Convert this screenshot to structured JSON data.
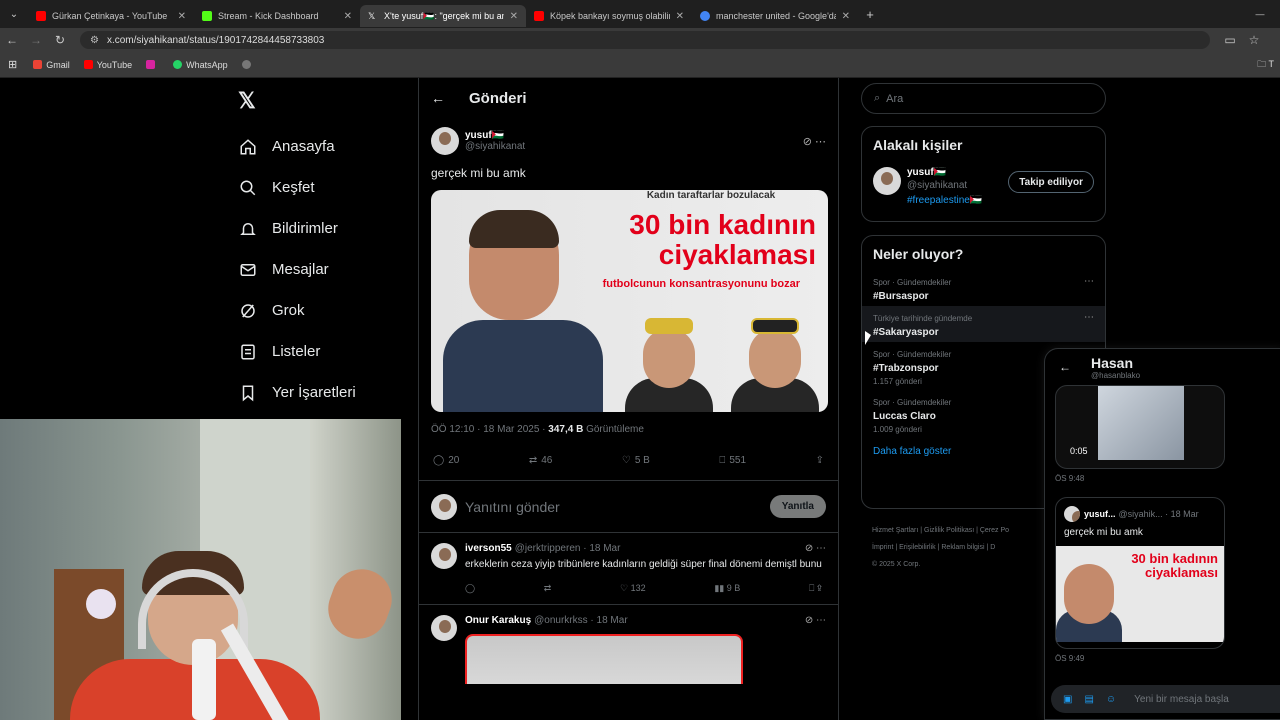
{
  "browser": {
    "tabs": [
      {
        "title": "Gürkan Çetinkaya - YouTube",
        "color": "#ff0000",
        "active": false
      },
      {
        "title": "Stream - Kick Dashboard",
        "color": "#53fc18",
        "active": false
      },
      {
        "title": "X'te yusuf🇵🇸: \"gerçek mi bu amk",
        "color": "#ffffff",
        "active": true
      },
      {
        "title": "Köpek bankayı soymuş olabilir",
        "color": "#ff0000",
        "active": false
      },
      {
        "title": "manchester united - Google'da",
        "color": "#4285f4",
        "active": false
      }
    ],
    "url": "x.com/siyahikanat/status/1901742844458733803",
    "bookmarks": [
      "Gmail",
      "YouTube",
      "WhatsApp"
    ],
    "bookmarks_right": "T"
  },
  "nav": {
    "items": [
      "Anasayfa",
      "Keşfet",
      "Bildirimler",
      "Mesajlar",
      "Grok",
      "Listeler",
      "Yer İşaretleri"
    ]
  },
  "main": {
    "header": "Gönderi",
    "post": {
      "display_name": "yusuf🇵🇸",
      "handle": "@siyahikanat",
      "text": "gerçek mi bu amk",
      "image": {
        "top_band": "Kadın taraftarlar bozulacak",
        "headline1": "30 bin kadının",
        "headline2": "ciyaklaması",
        "subline": "futbolcunun konsantrasyonunu bozar"
      },
      "time": "ÖÖ 12:10 · 18 Mar 2025 · ",
      "views": "347,4 B",
      "views_label": " Görüntüleme",
      "replies": "20",
      "reposts": "46",
      "likes": "5 B",
      "bookmarks": "551"
    },
    "reply_placeholder": "Yanıtını gönder",
    "reply_button": "Yanıtla",
    "comments": [
      {
        "name": "iverson55",
        "handle": "@jerktripperen · 18 Mar",
        "text": "erkeklerin ceza yiyip tribünlere kadınların geldiği süper final dönemi demiştl bunu",
        "likes": "132",
        "views": "9 B"
      },
      {
        "name": "Onur Karakuş",
        "handle": "@onurkrkss · 18 Mar"
      }
    ]
  },
  "right": {
    "search_placeholder": "Ara",
    "related_title": "Alakalı kişiler",
    "related": {
      "name": "yusuf🇵🇸",
      "handle": "@siyahikanat",
      "bio": "#freepalestine🇵🇸",
      "button": "Takip ediliyor"
    },
    "trends_title": "Neler oluyor?",
    "trends": [
      {
        "context": "Spor · Gündemdekiler",
        "name": "#Bursaspor",
        "count": ""
      },
      {
        "context": "Türkiye tarihinde gündemde",
        "name": "#Sakaryaspor",
        "count": ""
      },
      {
        "context": "Spor · Gündemdekiler",
        "name": "#Trabzonspor",
        "count": "1.157 gönderi"
      },
      {
        "context": "Spor · Gündemdekiler",
        "name": "Luccas Claro",
        "count": "1.009 gönderi"
      }
    ],
    "show_more": "Daha fazla göster",
    "footer": {
      "line1": "Hizmet Şartları | Gizlilik Politikası | Çerez Po",
      "line2": "İmprint | Erişilebilirlik | Reklam bilgisi | D",
      "line3": "© 2025 X Corp."
    }
  },
  "dm": {
    "name": "Hasan",
    "handle": "@hasanblako",
    "video_duration": "0:05",
    "time1": "ÖS 9:48",
    "shared_name": "yusuf...",
    "shared_handle": "@siyahik... · 18 Mar",
    "shared_text": "gerçek mi bu amk",
    "shared_headline1": "30 bin kadının",
    "shared_headline2": "ciyaklaması",
    "time2": "ÖS 9:49",
    "input_placeholder": "Yeni bir mesaja başla"
  }
}
